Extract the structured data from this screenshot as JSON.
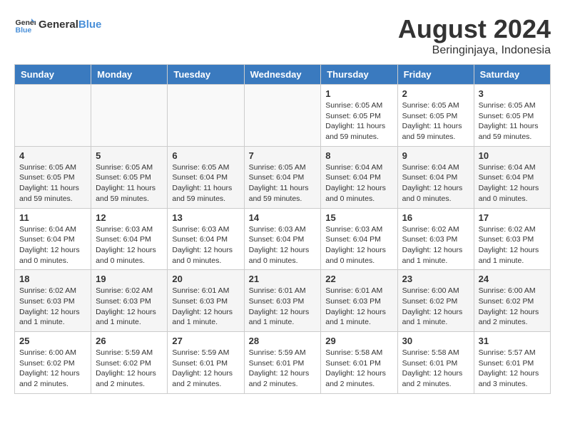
{
  "logo": {
    "text_general": "General",
    "text_blue": "Blue"
  },
  "title": "August 2024",
  "subtitle": "Beringinjaya, Indonesia",
  "weekdays": [
    "Sunday",
    "Monday",
    "Tuesday",
    "Wednesday",
    "Thursday",
    "Friday",
    "Saturday"
  ],
  "weeks": [
    [
      {
        "day": "",
        "info": ""
      },
      {
        "day": "",
        "info": ""
      },
      {
        "day": "",
        "info": ""
      },
      {
        "day": "",
        "info": ""
      },
      {
        "day": "1",
        "info": "Sunrise: 6:05 AM\nSunset: 6:05 PM\nDaylight: 11 hours and 59 minutes."
      },
      {
        "day": "2",
        "info": "Sunrise: 6:05 AM\nSunset: 6:05 PM\nDaylight: 11 hours and 59 minutes."
      },
      {
        "day": "3",
        "info": "Sunrise: 6:05 AM\nSunset: 6:05 PM\nDaylight: 11 hours and 59 minutes."
      }
    ],
    [
      {
        "day": "4",
        "info": "Sunrise: 6:05 AM\nSunset: 6:05 PM\nDaylight: 11 hours and 59 minutes."
      },
      {
        "day": "5",
        "info": "Sunrise: 6:05 AM\nSunset: 6:05 PM\nDaylight: 11 hours and 59 minutes."
      },
      {
        "day": "6",
        "info": "Sunrise: 6:05 AM\nSunset: 6:04 PM\nDaylight: 11 hours and 59 minutes."
      },
      {
        "day": "7",
        "info": "Sunrise: 6:05 AM\nSunset: 6:04 PM\nDaylight: 11 hours and 59 minutes."
      },
      {
        "day": "8",
        "info": "Sunrise: 6:04 AM\nSunset: 6:04 PM\nDaylight: 12 hours and 0 minutes."
      },
      {
        "day": "9",
        "info": "Sunrise: 6:04 AM\nSunset: 6:04 PM\nDaylight: 12 hours and 0 minutes."
      },
      {
        "day": "10",
        "info": "Sunrise: 6:04 AM\nSunset: 6:04 PM\nDaylight: 12 hours and 0 minutes."
      }
    ],
    [
      {
        "day": "11",
        "info": "Sunrise: 6:04 AM\nSunset: 6:04 PM\nDaylight: 12 hours and 0 minutes."
      },
      {
        "day": "12",
        "info": "Sunrise: 6:03 AM\nSunset: 6:04 PM\nDaylight: 12 hours and 0 minutes."
      },
      {
        "day": "13",
        "info": "Sunrise: 6:03 AM\nSunset: 6:04 PM\nDaylight: 12 hours and 0 minutes."
      },
      {
        "day": "14",
        "info": "Sunrise: 6:03 AM\nSunset: 6:04 PM\nDaylight: 12 hours and 0 minutes."
      },
      {
        "day": "15",
        "info": "Sunrise: 6:03 AM\nSunset: 6:04 PM\nDaylight: 12 hours and 0 minutes."
      },
      {
        "day": "16",
        "info": "Sunrise: 6:02 AM\nSunset: 6:03 PM\nDaylight: 12 hours and 1 minute."
      },
      {
        "day": "17",
        "info": "Sunrise: 6:02 AM\nSunset: 6:03 PM\nDaylight: 12 hours and 1 minute."
      }
    ],
    [
      {
        "day": "18",
        "info": "Sunrise: 6:02 AM\nSunset: 6:03 PM\nDaylight: 12 hours and 1 minute."
      },
      {
        "day": "19",
        "info": "Sunrise: 6:02 AM\nSunset: 6:03 PM\nDaylight: 12 hours and 1 minute."
      },
      {
        "day": "20",
        "info": "Sunrise: 6:01 AM\nSunset: 6:03 PM\nDaylight: 12 hours and 1 minute."
      },
      {
        "day": "21",
        "info": "Sunrise: 6:01 AM\nSunset: 6:03 PM\nDaylight: 12 hours and 1 minute."
      },
      {
        "day": "22",
        "info": "Sunrise: 6:01 AM\nSunset: 6:03 PM\nDaylight: 12 hours and 1 minute."
      },
      {
        "day": "23",
        "info": "Sunrise: 6:00 AM\nSunset: 6:02 PM\nDaylight: 12 hours and 1 minute."
      },
      {
        "day": "24",
        "info": "Sunrise: 6:00 AM\nSunset: 6:02 PM\nDaylight: 12 hours and 2 minutes."
      }
    ],
    [
      {
        "day": "25",
        "info": "Sunrise: 6:00 AM\nSunset: 6:02 PM\nDaylight: 12 hours and 2 minutes."
      },
      {
        "day": "26",
        "info": "Sunrise: 5:59 AM\nSunset: 6:02 PM\nDaylight: 12 hours and 2 minutes."
      },
      {
        "day": "27",
        "info": "Sunrise: 5:59 AM\nSunset: 6:01 PM\nDaylight: 12 hours and 2 minutes."
      },
      {
        "day": "28",
        "info": "Sunrise: 5:59 AM\nSunset: 6:01 PM\nDaylight: 12 hours and 2 minutes."
      },
      {
        "day": "29",
        "info": "Sunrise: 5:58 AM\nSunset: 6:01 PM\nDaylight: 12 hours and 2 minutes."
      },
      {
        "day": "30",
        "info": "Sunrise: 5:58 AM\nSunset: 6:01 PM\nDaylight: 12 hours and 2 minutes."
      },
      {
        "day": "31",
        "info": "Sunrise: 5:57 AM\nSunset: 6:01 PM\nDaylight: 12 hours and 3 minutes."
      }
    ]
  ]
}
